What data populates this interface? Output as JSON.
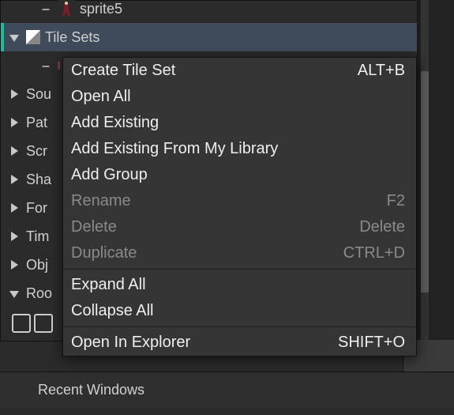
{
  "tree": {
    "sprite5": "sprite5",
    "tilesets": "Tile Sets",
    "tileset_child": "ti",
    "sounds": "Sou",
    "paths": "Pat",
    "scripts": "Scr",
    "shaders": "Sha",
    "fonts": "For",
    "timelines": "Tim",
    "objects": "Obj",
    "rooms": "Roo"
  },
  "context_menu": {
    "create": {
      "label": "Create Tile Set",
      "shortcut": "ALT+B"
    },
    "open_all": {
      "label": "Open All"
    },
    "add_existing": {
      "label": "Add Existing"
    },
    "add_library": {
      "label": "Add Existing From My Library"
    },
    "add_group": {
      "label": "Add Group"
    },
    "rename": {
      "label": "Rename",
      "shortcut": "F2"
    },
    "delete": {
      "label": "Delete",
      "shortcut": "Delete"
    },
    "duplicate": {
      "label": "Duplicate",
      "shortcut": "CTRL+D"
    },
    "expand_all": {
      "label": "Expand All"
    },
    "collapse_all": {
      "label": "Collapse All"
    },
    "open_explorer": {
      "label": "Open In Explorer",
      "shortcut": "SHIFT+O"
    }
  },
  "panels": {
    "recent": "Recent Windows"
  },
  "colors": {
    "selection": "#3f4b5a",
    "accent": "#1abc9c",
    "panel": "#2b2b2b",
    "menu": "#353535"
  }
}
